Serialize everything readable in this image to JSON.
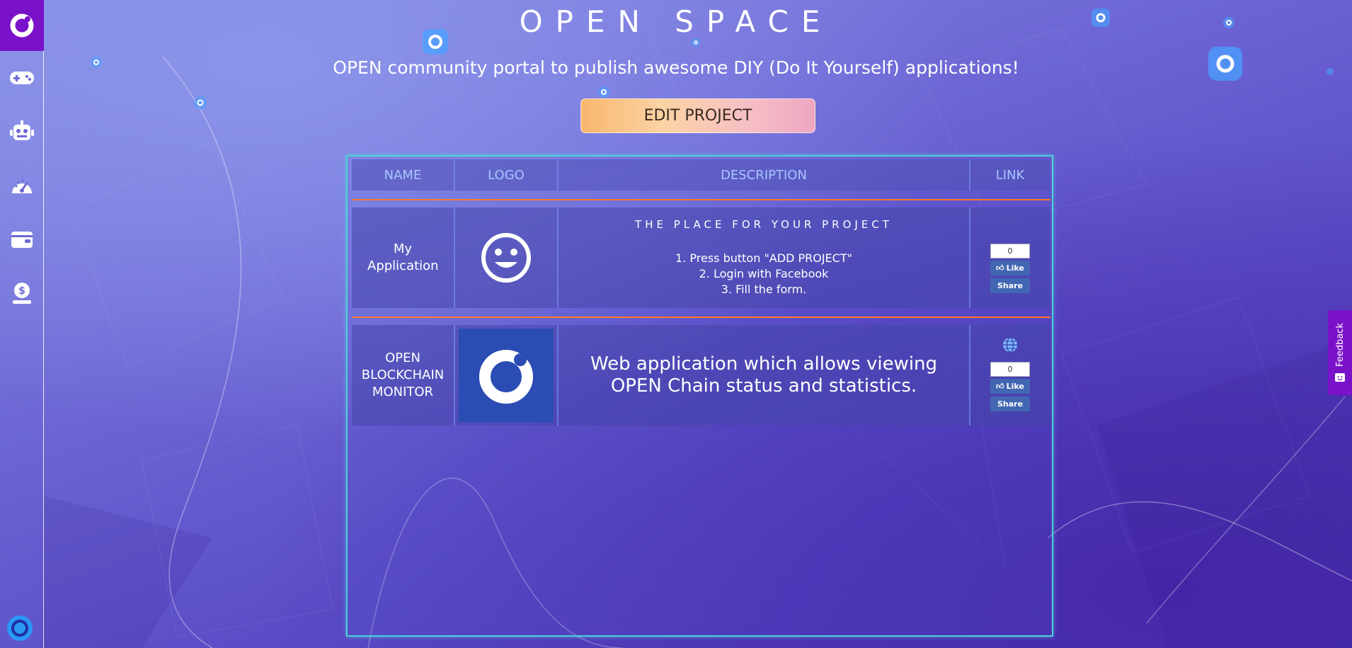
{
  "header": {
    "title": "OPEN SPACE",
    "subtitle": "OPEN community portal to publish awesome DIY (Do It Yourself) applications!",
    "edit_button": "EDIT PROJECT"
  },
  "sidebar": {
    "items": [
      {
        "icon": "gamepad-icon"
      },
      {
        "icon": "robot-icon"
      },
      {
        "icon": "speedometer-icon"
      },
      {
        "icon": "wallet-icon"
      },
      {
        "icon": "money-hand-icon"
      }
    ]
  },
  "table": {
    "columns": [
      "NAME",
      "LOGO",
      "DESCRIPTION",
      "LINK"
    ],
    "rows": [
      {
        "name": "My Application",
        "logo_icon": "smiley-icon",
        "description_title": "THE PLACE FOR YOUR PROJECT",
        "steps": [
          "1. Press button \"ADD PROJECT\"",
          "2. Login with Facebook",
          "3. Fill the form."
        ],
        "like_count": "0",
        "like_label": "Like",
        "share_label": "Share"
      },
      {
        "name": "OPEN BLOCKCHAIN MONITOR",
        "logo_icon": "open-logo-icon",
        "description": "Web application which allows viewing OPEN Chain status and statistics.",
        "link_icon": "globe-icon",
        "like_count": "0",
        "like_label": "Like",
        "share_label": "Share"
      }
    ]
  },
  "feedback": {
    "label": "Feedback"
  },
  "colors": {
    "accent_purple": "#7a12c9",
    "panel_border": "#4fd0d8",
    "separator": "#ff7a2a",
    "facebook_blue": "#4267b2"
  }
}
